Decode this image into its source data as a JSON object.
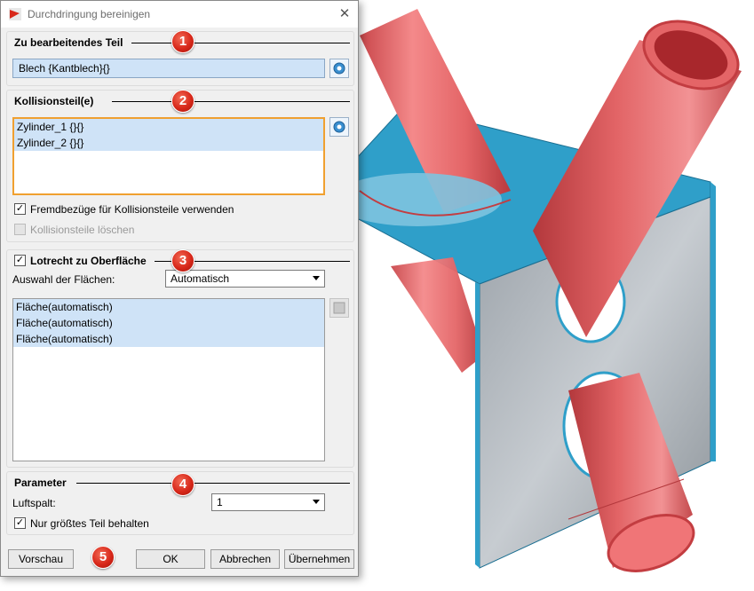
{
  "dialog": {
    "title": "Durchdringung bereinigen",
    "close_glyph": "✕"
  },
  "groups": {
    "part": {
      "header": "Zu bearbeitendes Teil",
      "badge": "1",
      "field_value": "Blech {Kantblech}{}"
    },
    "collision": {
      "header": "Kollisionsteil(e)",
      "badge": "2",
      "items": [
        "Zylinder_1 {}{}",
        "Zylinder_2 {}{}"
      ],
      "check_foreign": {
        "label": "Fremdbezüge für Kollisionsteile verwenden",
        "checked": true
      },
      "check_delete": {
        "label": "Kollisionsteile löschen",
        "checked": false,
        "disabled": true
      }
    },
    "perpendicular": {
      "header": "Lotrecht zu Oberfläche",
      "checked": true,
      "badge": "3",
      "selection_label": "Auswahl der Flächen:",
      "selection_value": "Automatisch",
      "faces": [
        "Fläche(automatisch)",
        "Fläche(automatisch)",
        "Fläche(automatisch)"
      ]
    },
    "parameter": {
      "header": "Parameter",
      "badge": "4",
      "gap_label": "Luftspalt:",
      "gap_value": "1",
      "keep_largest": {
        "label": "Nur größtes Teil behalten",
        "checked": true
      }
    }
  },
  "buttons": {
    "preview": "Vorschau",
    "badge": "5",
    "ok": "OK",
    "cancel": "Abbrechen",
    "apply": "Übernehmen"
  },
  "colors": {
    "cylinder": "#e8696b",
    "sheet_metal": "#2f9fc9",
    "badge": "#d8281a",
    "selection": "#cfe3f7",
    "focus": "#f0a030"
  },
  "icons": [
    "app-icon",
    "close-icon",
    "pick-part-icon",
    "pick-collision-icon",
    "pick-face-icon",
    "check-icon",
    "dropdown-arrow-icon"
  ]
}
